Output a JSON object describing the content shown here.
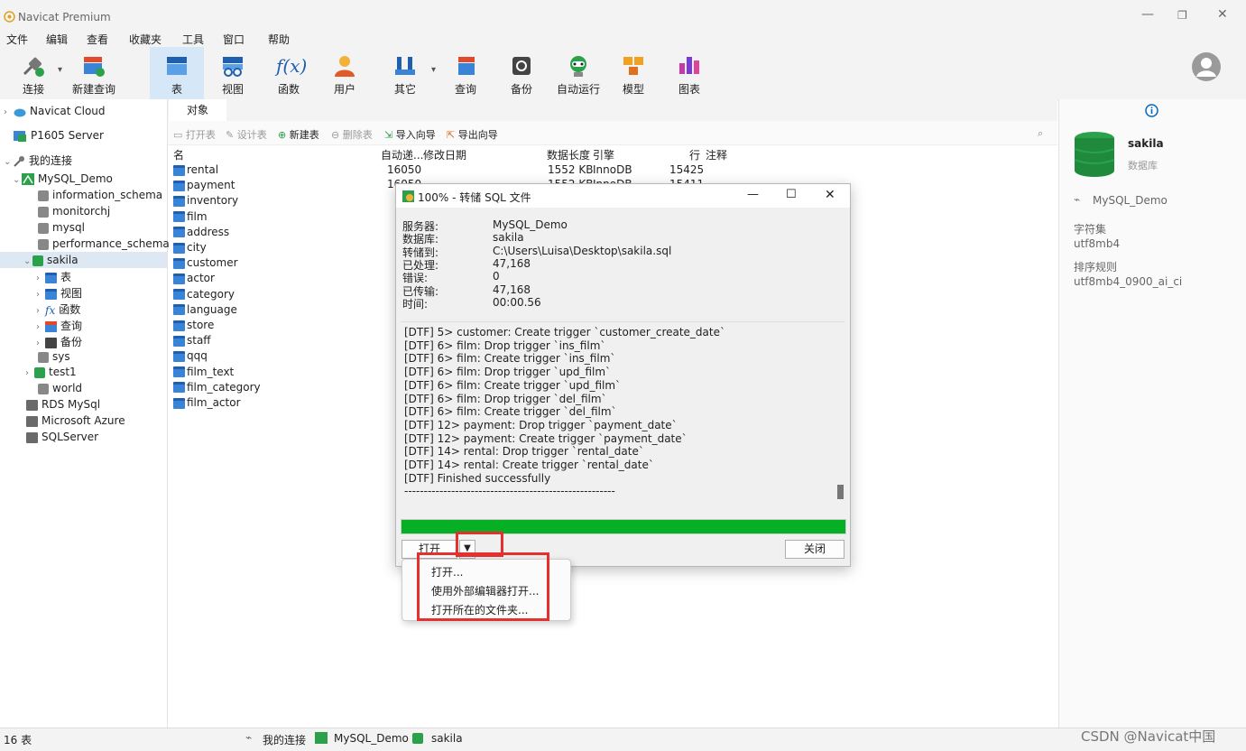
{
  "app": {
    "title": "Navicat Premium"
  },
  "menu": [
    "文件",
    "编辑",
    "查看",
    "收藏夹",
    "工具",
    "窗口",
    "帮助"
  ],
  "toolbar": {
    "connect": "连接",
    "new_query": "新建查询",
    "table": "表",
    "view": "视图",
    "function": "函数",
    "user": "用户",
    "other": "其它",
    "query": "查询",
    "backup": "备份",
    "automation": "自动运行",
    "model": "模型",
    "chart": "图表"
  },
  "tree": {
    "cloud": "Navicat Cloud",
    "p1605": "P1605 Server",
    "my_connections": "我的连接",
    "mysql_demo": "MySQL_Demo",
    "information_schema": "information_schema",
    "monitorchj": "monitorchj",
    "mysql": "mysql",
    "performance_schema": "performance_schema",
    "sakila": "sakila",
    "tables": "表",
    "views": "视图",
    "functions": "函数",
    "queries": "查询",
    "backups": "备份",
    "sys": "sys",
    "test1": "test1",
    "world": "world",
    "rds": "RDS MySql",
    "azure": "Microsoft Azure",
    "sqlserver": "SQLServer"
  },
  "objects": {
    "tab": "对象",
    "tb_open": "打开表",
    "tb_design": "设计表",
    "tb_new": "新建表",
    "tb_delete": "删除表",
    "tb_import": "导入向导",
    "tb_export": "导出向导",
    "col_name": "名",
    "col_autoinc": "自动递...",
    "col_modified": "修改日期",
    "col_datalen": "数据长度",
    "col_engine": "引擎",
    "col_rows": "行",
    "col_comment": "注释",
    "tables": [
      "rental",
      "payment",
      "inventory",
      "film",
      "address",
      "city",
      "customer",
      "actor",
      "category",
      "language",
      "store",
      "staff",
      "qqq",
      "film_text",
      "film_category",
      "film_actor"
    ],
    "row1": {
      "autoinc": "16050",
      "datalen": "1552 KB",
      "engine": "InnoDB",
      "rows": "15425"
    },
    "row2": {
      "autoinc": "16050",
      "datalen": "1552 KB",
      "engine": "InnoDB",
      "rows": "15411"
    }
  },
  "right": {
    "db_name": "sakila",
    "db_type": "数据库",
    "connection": "MySQL_Demo",
    "charset_label": "字符集",
    "charset": "utf8mb4",
    "collation_label": "排序规则",
    "collation": "utf8mb4_0900_ai_ci"
  },
  "status": {
    "count": "16 表",
    "conn_label": "我的连接",
    "conn": "MySQL_Demo",
    "db": "sakila",
    "watermark": "CSDN @Navicat中国"
  },
  "dialog": {
    "title": "100% - 转储 SQL 文件",
    "server_k": "服务器:",
    "server_v": "MySQL_Demo",
    "db_k": "数据库:",
    "db_v": "sakila",
    "dump_k": "转储到:",
    "dump_v": "C:\\Users\\Luisa\\Desktop\\sakila.sql",
    "processed_k": "已处理:",
    "processed_v": "47,168",
    "errors_k": "错误:",
    "errors_v": "0",
    "transferred_k": "已传输:",
    "transferred_v": "47,168",
    "time_k": "时间:",
    "time_v": "00:00.56",
    "log": [
      "[DTF] 5> customer: Create trigger `customer_create_date`",
      "[DTF] 6> film: Drop trigger `ins_film`",
      "[DTF] 6> film: Create trigger `ins_film`",
      "[DTF] 6> film: Drop trigger `upd_film`",
      "[DTF] 6> film: Create trigger `upd_film`",
      "[DTF] 6> film: Drop trigger `del_film`",
      "[DTF] 6> film: Create trigger `del_film`",
      "[DTF] 12> payment: Drop trigger `payment_date`",
      "[DTF] 12> payment: Create trigger `payment_date`",
      "[DTF] 14> rental: Drop trigger `rental_date`",
      "[DTF] 14> rental: Create trigger `rental_date`",
      "[DTF] Finished successfully",
      "------------------------------------------------------"
    ],
    "progress": 1.0,
    "open_btn": "打开",
    "close_btn": "关闭",
    "menu": [
      "打开...",
      "使用外部编辑器打开...",
      "打开所在的文件夹..."
    ]
  },
  "colors": {
    "accent": "#0067c0",
    "progress": "#06b025",
    "highlight": "#e53030",
    "db_green": "#2aa14a"
  }
}
